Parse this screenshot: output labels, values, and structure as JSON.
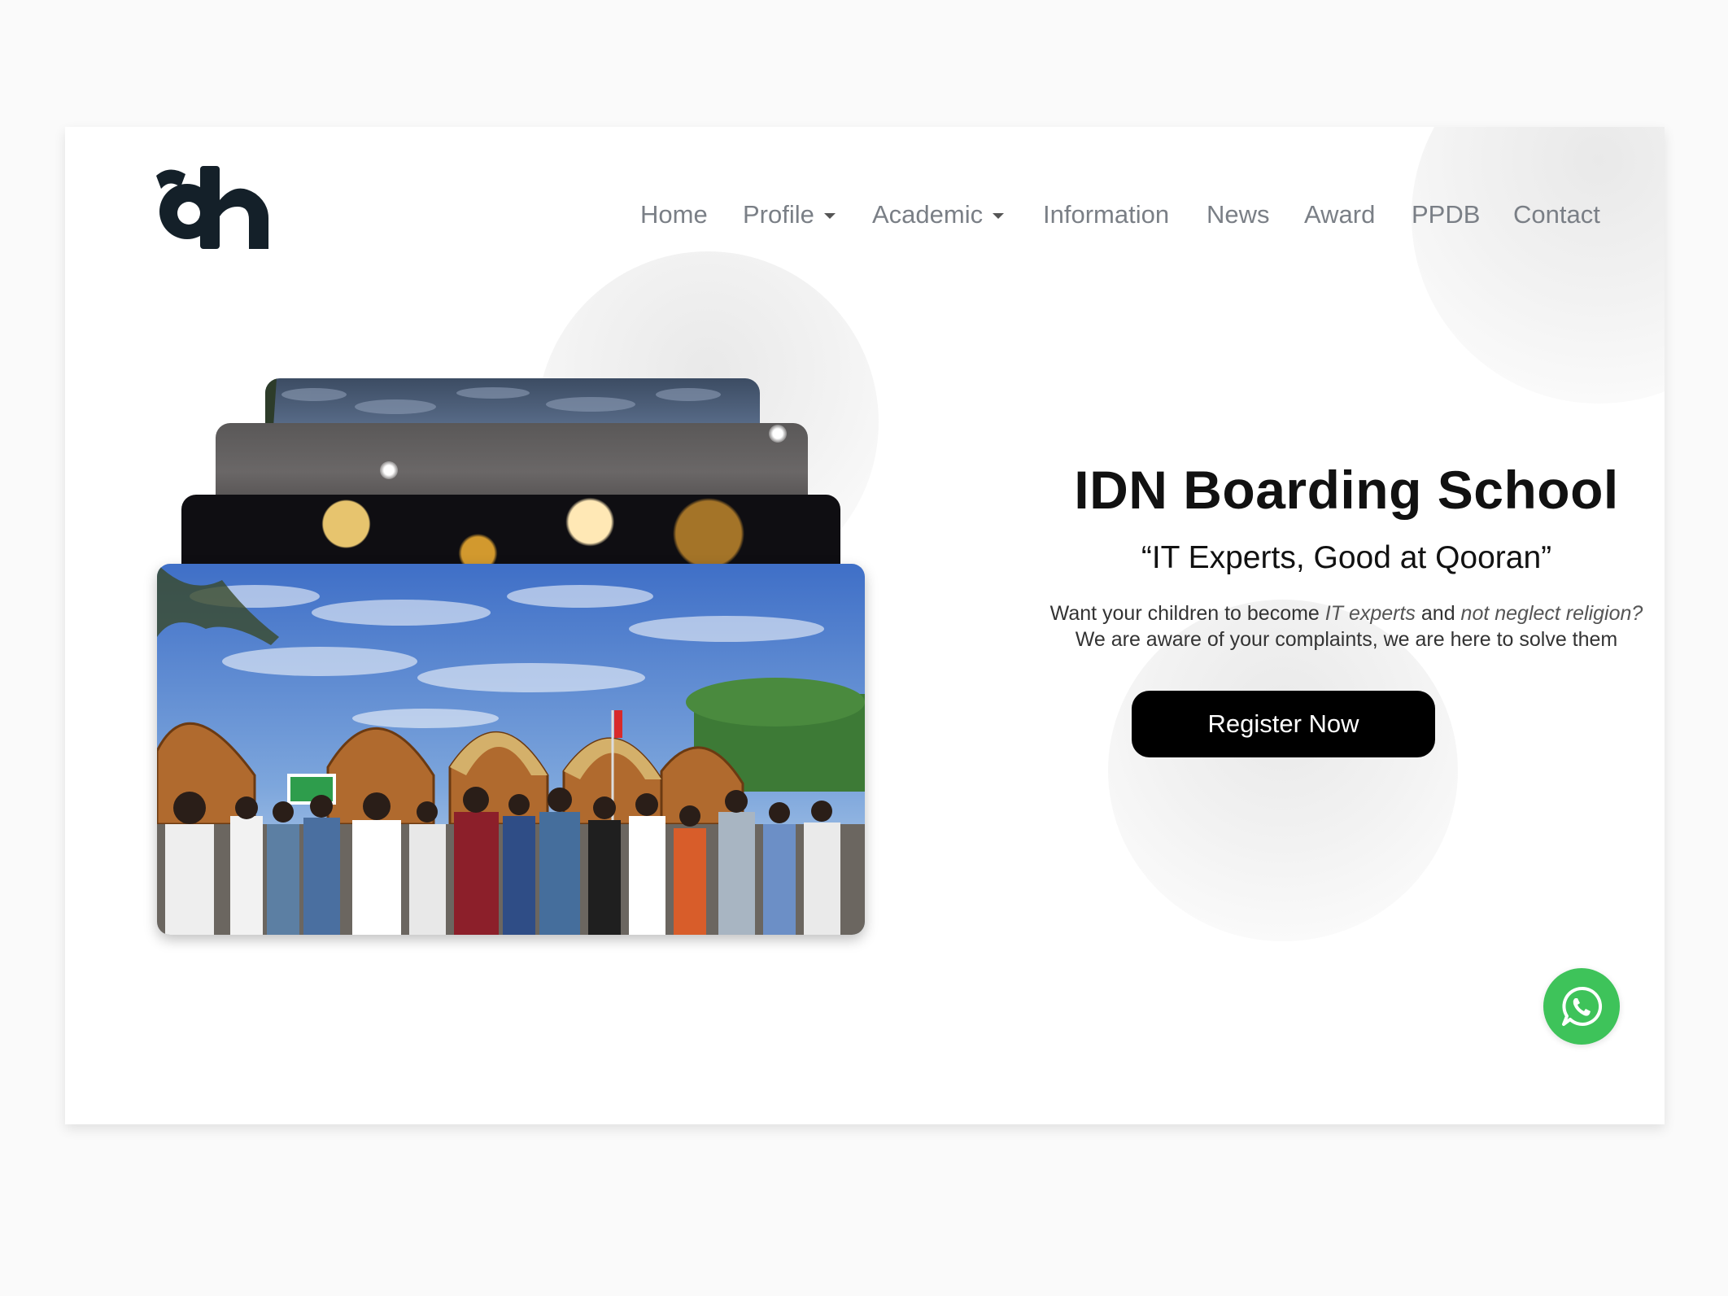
{
  "logo": {
    "alt": "idn"
  },
  "nav": {
    "items": [
      {
        "label": "Home",
        "has_dropdown": false
      },
      {
        "label": "Profile",
        "has_dropdown": true
      },
      {
        "label": "Academic",
        "has_dropdown": true
      },
      {
        "label": "Information",
        "has_dropdown": false
      },
      {
        "label": "News",
        "has_dropdown": false
      },
      {
        "label": "Award",
        "has_dropdown": false
      },
      {
        "label": "PPDB",
        "has_dropdown": false
      },
      {
        "label": "Contact",
        "has_dropdown": false
      }
    ]
  },
  "hero": {
    "title": "IDN Boarding School",
    "tagline": "“IT Experts, Good at Qooran”",
    "description": {
      "part1": "Want your children to become ",
      "em1": "IT experts",
      "part2": " and ",
      "em2": "not neglect religion?",
      "line2": "We are aware of your complaints, we are here to solve them"
    },
    "cta_label": "Register Now"
  },
  "gallery": {
    "cards": [
      "sky-photo",
      "lamp-photo",
      "bokeh-photo",
      "students-photo"
    ]
  },
  "whatsapp": {
    "icon": "whatsapp-icon"
  },
  "colors": {
    "accent": "#000000",
    "whatsapp": "#3EC35A",
    "nav_text": "#7A7F86",
    "logo": "#142029"
  }
}
